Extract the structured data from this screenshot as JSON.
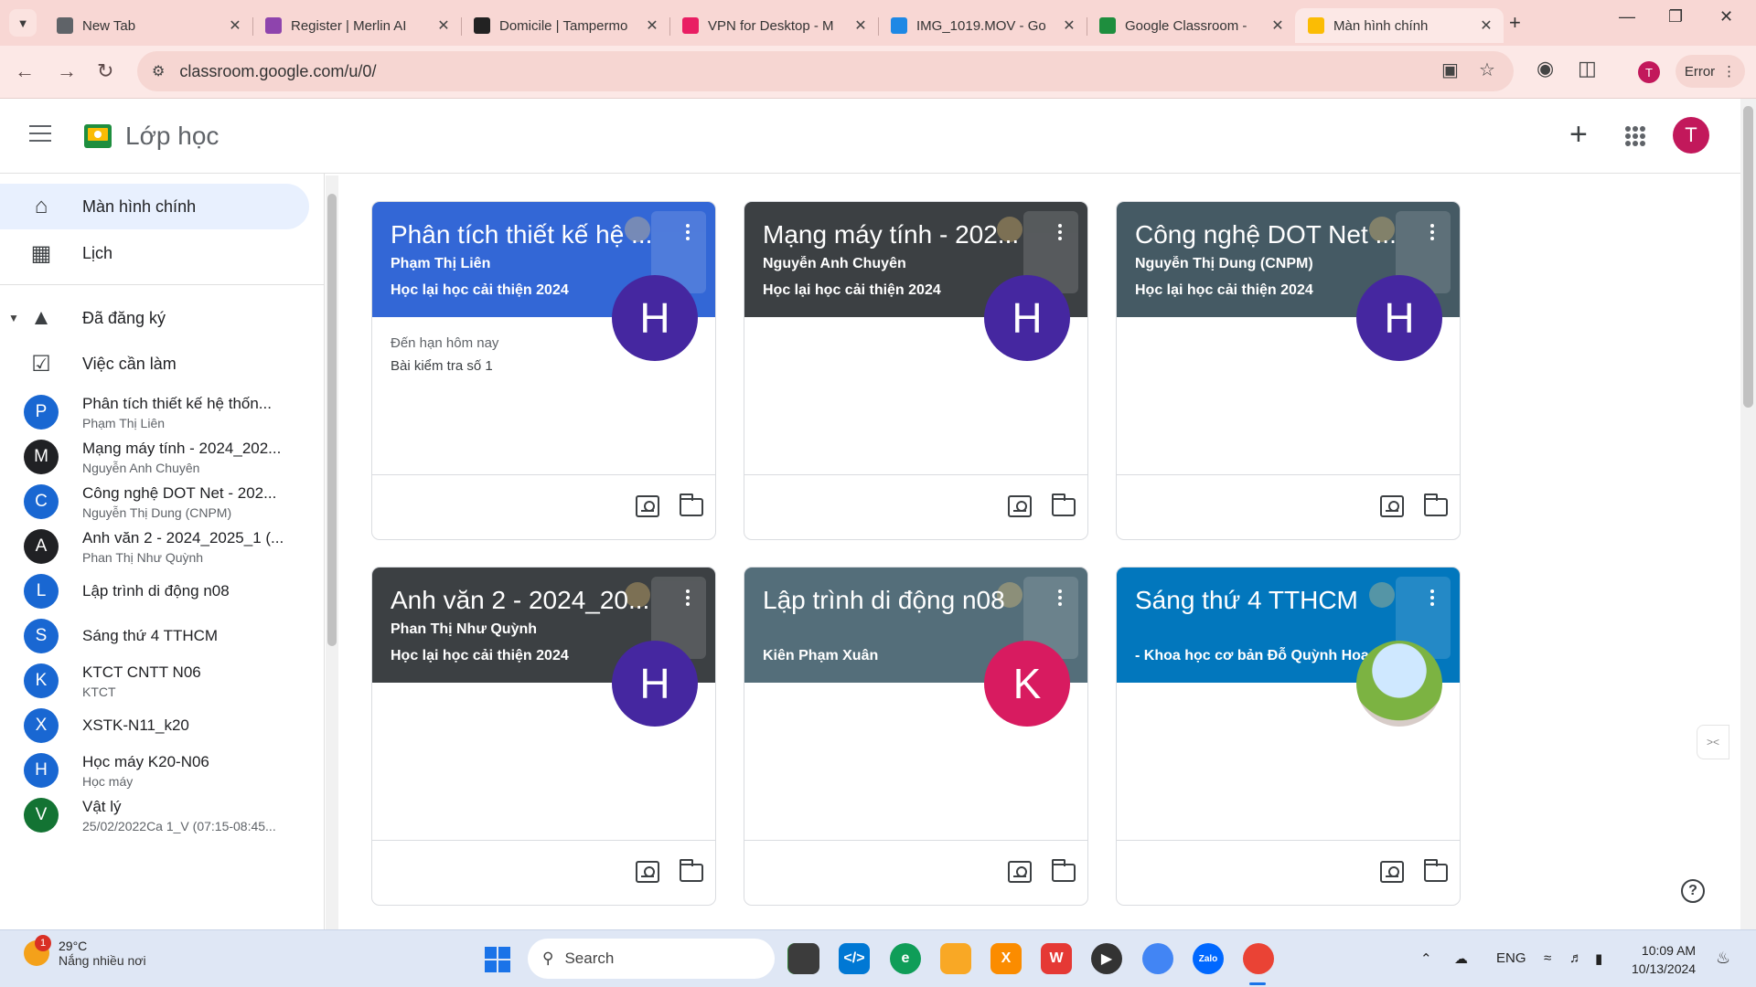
{
  "browser": {
    "tabs": [
      {
        "title": "New Tab",
        "favicon_color": "#5f6368"
      },
      {
        "title": "Register | Merlin AI",
        "favicon_color": "#8e44ad"
      },
      {
        "title": "Domicile | Tampermo",
        "favicon_color": "#222222"
      },
      {
        "title": "VPN for Desktop - M",
        "favicon_color": "#e91e63"
      },
      {
        "title": "IMG_1019.MOV - Go",
        "favicon_color": "#1e88e5"
      },
      {
        "title": "Google Classroom - ",
        "favicon_color": "#1e8e3e"
      },
      {
        "title": "Màn hình chính",
        "favicon_color": "#fbbc04",
        "active": true
      }
    ],
    "url": "classroom.google.com/u/0/",
    "profile_initial": "T",
    "error_label": "Error"
  },
  "app": {
    "title": "Lớp học",
    "user_initial": "T"
  },
  "sidebar": {
    "nav": [
      {
        "label": "Màn hình chính",
        "icon": "home-icon"
      },
      {
        "label": "Lịch",
        "icon": "calendar-icon"
      }
    ],
    "enrolled_label": "Đã đăng ký",
    "todo_label": "Việc cần làm",
    "courses": [
      {
        "initial": "P",
        "name": "Phân tích thiết kế hệ thốn...",
        "sub": "Phạm Thị Liên",
        "color": "#1967d2"
      },
      {
        "initial": "M",
        "name": "Mạng máy tính - 2024_202...",
        "sub": "Nguyễn Anh Chuyên",
        "color": "#202124"
      },
      {
        "initial": "C",
        "name": "Công nghệ DOT Net - 202...",
        "sub": "Nguyễn Thị Dung (CNPM)",
        "color": "#1967d2"
      },
      {
        "initial": "A",
        "name": "Anh văn 2 - 2024_2025_1 (...",
        "sub": "Phan Thị Như Quỳnh",
        "color": "#202124"
      },
      {
        "initial": "L",
        "name": "Lập trình di động n08",
        "sub": "",
        "color": "#1967d2"
      },
      {
        "initial": "S",
        "name": "Sáng thứ 4 TTHCM",
        "sub": "",
        "color": "#1967d2"
      },
      {
        "initial": "K",
        "name": "KTCT CNTT N06",
        "sub": "KTCT",
        "color": "#1967d2"
      },
      {
        "initial": "X",
        "name": "XSTK-N11_k20",
        "sub": "",
        "color": "#1967d2"
      },
      {
        "initial": "H",
        "name": "Học máy K20-N06",
        "sub": "Học máy",
        "color": "#1967d2"
      },
      {
        "initial": "V",
        "name": "Vật lý",
        "sub": "25/02/2022Ca 1_V (07:15-08:45...",
        "color": "#137333"
      }
    ]
  },
  "cards": [
    {
      "title": "Phân tích thiết kế hệ ...",
      "teacher": "Phạm Thị Liên",
      "section": "Học lại học cải thiện 2024",
      "avatar": "H",
      "avatar_color": "#4527a0",
      "header_color": "#3367d6",
      "due_label": "Đến hạn hôm nay",
      "due_item": "Bài kiểm tra số 1"
    },
    {
      "title": "Mạng máy tính - 202...",
      "teacher": "Nguyễn Anh Chuyên",
      "section": "Học lại học cải thiện 2024",
      "avatar": "H",
      "avatar_color": "#4527a0",
      "header_color": "#3c4043",
      "due_label": "",
      "due_item": ""
    },
    {
      "title": "Công nghệ DOT Net ...",
      "teacher": "Nguyễn Thị Dung (CNPM)",
      "section": "Học lại học cải thiện 2024",
      "avatar": "H",
      "avatar_color": "#4527a0",
      "header_color": "#455a64",
      "due_label": "",
      "due_item": ""
    },
    {
      "title": "Anh văn 2 - 2024_20...",
      "teacher": "Phan Thị Như Quỳnh",
      "section": "Học lại học cải thiện 2024",
      "avatar": "H",
      "avatar_color": "#4527a0",
      "header_color": "#3c4043",
      "due_label": "",
      "due_item": ""
    },
    {
      "title": "Lập trình di động n08",
      "teacher": "",
      "section": "Kiên Phạm Xuân",
      "avatar": "K",
      "avatar_color": "#d81b60",
      "header_color": "#546e7a",
      "due_label": "",
      "due_item": ""
    },
    {
      "title": "Sáng thứ 4 TTHCM",
      "teacher": "",
      "section": "- Khoa học cơ bản Đỗ Quỳnh Hoa",
      "avatar": "",
      "avatar_color": "#8bc34a",
      "header_color": "#0277bd",
      "due_label": "",
      "due_item": ""
    }
  ],
  "taskbar": {
    "temperature": "29°C",
    "weather": "Nắng nhiều nơi",
    "weather_badge": "1",
    "search_label": "Search",
    "language": "ENG",
    "time": "10:09 AM",
    "date": "10/13/2024"
  }
}
